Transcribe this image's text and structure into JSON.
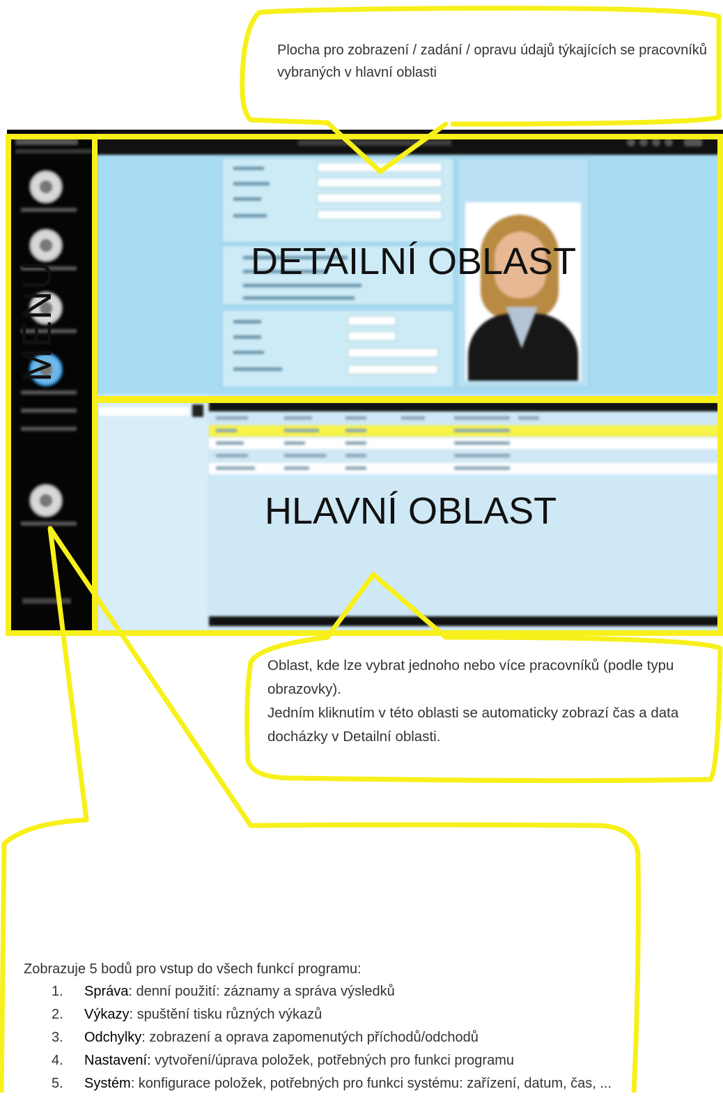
{
  "callouts": {
    "detail_desc": "Plocha pro zobrazení / zadání / opravu údajů týkajících se pracovníků vybraných v hlavní oblasti",
    "main_desc_1": "Oblast, kde lze vybrat jednoho nebo více pracovníků (podle typu obrazovky).",
    "main_desc_2": "Jedním kliknutím v této oblasti se automaticky zobrazí čas a data docházky v Detailní oblasti.",
    "menu_intro": "Zobrazuje 5 bodů pro vstup do všech funkcí programu:",
    "menu_items": [
      {
        "num": "1.",
        "term": "Správa",
        "text": ": denní použití: záznamy a správa výsledků"
      },
      {
        "num": "2.",
        "term": "Výkazy",
        "text": ": spuštění tisku různých výkazů"
      },
      {
        "num": "3.",
        "term": "Odchylky",
        "text": ": zobrazení a oprava zapomenutých příchodů/odchodů"
      },
      {
        "num": "4.",
        "term": "Nastavení:",
        "text": " vytvoření/úprava položek, potřebných pro funkci programu"
      },
      {
        "num": "5.",
        "term": "Systém",
        "text": ": konfigurace položek, potřebných pro funkci systému: zařízení, datum, čas, ..."
      }
    ]
  },
  "labels": {
    "detail": "DETAILNÍ OBLAST",
    "main": "HLAVNÍ OBLAST",
    "menu": "MENU"
  },
  "colors": {
    "highlight": "#f7f01a",
    "detail_bg": "#a7dcf3",
    "main_bg": "#cfe8f6",
    "selected_row": "#f7f347"
  }
}
